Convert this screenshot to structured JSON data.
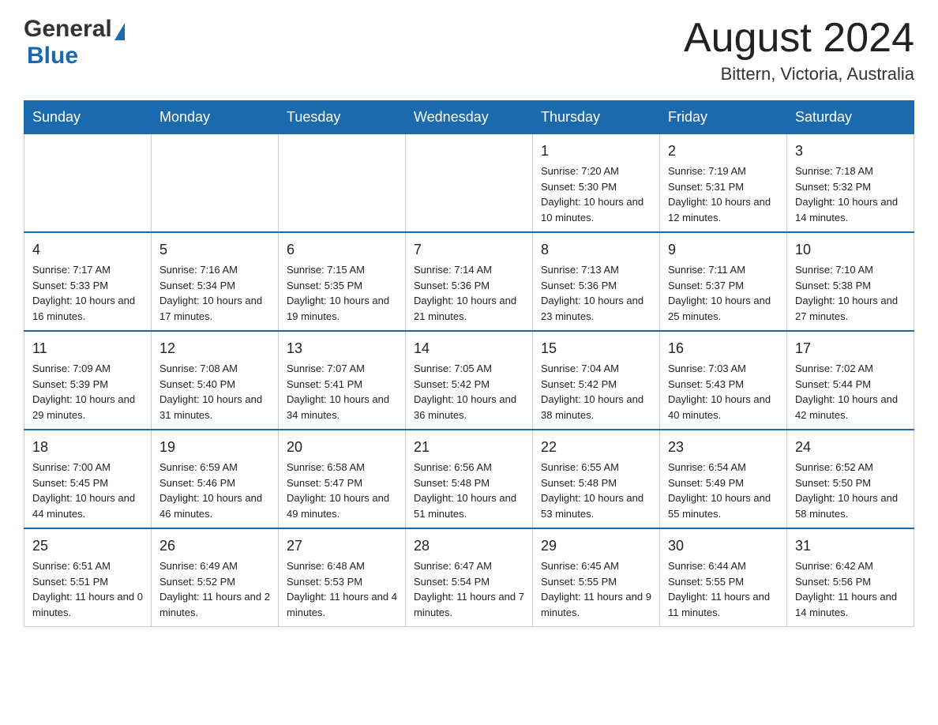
{
  "header": {
    "logo": {
      "general": "General",
      "blue": "Blue",
      "triangle": "▲"
    },
    "title": "August 2024",
    "location": "Bittern, Victoria, Australia"
  },
  "calendar": {
    "days": [
      "Sunday",
      "Monday",
      "Tuesday",
      "Wednesday",
      "Thursday",
      "Friday",
      "Saturday"
    ],
    "weeks": [
      {
        "cells": [
          {
            "day": "",
            "info": ""
          },
          {
            "day": "",
            "info": ""
          },
          {
            "day": "",
            "info": ""
          },
          {
            "day": "",
            "info": ""
          },
          {
            "day": "1",
            "info": "Sunrise: 7:20 AM\nSunset: 5:30 PM\nDaylight: 10 hours and 10 minutes."
          },
          {
            "day": "2",
            "info": "Sunrise: 7:19 AM\nSunset: 5:31 PM\nDaylight: 10 hours and 12 minutes."
          },
          {
            "day": "3",
            "info": "Sunrise: 7:18 AM\nSunset: 5:32 PM\nDaylight: 10 hours and 14 minutes."
          }
        ]
      },
      {
        "cells": [
          {
            "day": "4",
            "info": "Sunrise: 7:17 AM\nSunset: 5:33 PM\nDaylight: 10 hours and 16 minutes."
          },
          {
            "day": "5",
            "info": "Sunrise: 7:16 AM\nSunset: 5:34 PM\nDaylight: 10 hours and 17 minutes."
          },
          {
            "day": "6",
            "info": "Sunrise: 7:15 AM\nSunset: 5:35 PM\nDaylight: 10 hours and 19 minutes."
          },
          {
            "day": "7",
            "info": "Sunrise: 7:14 AM\nSunset: 5:36 PM\nDaylight: 10 hours and 21 minutes."
          },
          {
            "day": "8",
            "info": "Sunrise: 7:13 AM\nSunset: 5:36 PM\nDaylight: 10 hours and 23 minutes."
          },
          {
            "day": "9",
            "info": "Sunrise: 7:11 AM\nSunset: 5:37 PM\nDaylight: 10 hours and 25 minutes."
          },
          {
            "day": "10",
            "info": "Sunrise: 7:10 AM\nSunset: 5:38 PM\nDaylight: 10 hours and 27 minutes."
          }
        ]
      },
      {
        "cells": [
          {
            "day": "11",
            "info": "Sunrise: 7:09 AM\nSunset: 5:39 PM\nDaylight: 10 hours and 29 minutes."
          },
          {
            "day": "12",
            "info": "Sunrise: 7:08 AM\nSunset: 5:40 PM\nDaylight: 10 hours and 31 minutes."
          },
          {
            "day": "13",
            "info": "Sunrise: 7:07 AM\nSunset: 5:41 PM\nDaylight: 10 hours and 34 minutes."
          },
          {
            "day": "14",
            "info": "Sunrise: 7:05 AM\nSunset: 5:42 PM\nDaylight: 10 hours and 36 minutes."
          },
          {
            "day": "15",
            "info": "Sunrise: 7:04 AM\nSunset: 5:42 PM\nDaylight: 10 hours and 38 minutes."
          },
          {
            "day": "16",
            "info": "Sunrise: 7:03 AM\nSunset: 5:43 PM\nDaylight: 10 hours and 40 minutes."
          },
          {
            "day": "17",
            "info": "Sunrise: 7:02 AM\nSunset: 5:44 PM\nDaylight: 10 hours and 42 minutes."
          }
        ]
      },
      {
        "cells": [
          {
            "day": "18",
            "info": "Sunrise: 7:00 AM\nSunset: 5:45 PM\nDaylight: 10 hours and 44 minutes."
          },
          {
            "day": "19",
            "info": "Sunrise: 6:59 AM\nSunset: 5:46 PM\nDaylight: 10 hours and 46 minutes."
          },
          {
            "day": "20",
            "info": "Sunrise: 6:58 AM\nSunset: 5:47 PM\nDaylight: 10 hours and 49 minutes."
          },
          {
            "day": "21",
            "info": "Sunrise: 6:56 AM\nSunset: 5:48 PM\nDaylight: 10 hours and 51 minutes."
          },
          {
            "day": "22",
            "info": "Sunrise: 6:55 AM\nSunset: 5:48 PM\nDaylight: 10 hours and 53 minutes."
          },
          {
            "day": "23",
            "info": "Sunrise: 6:54 AM\nSunset: 5:49 PM\nDaylight: 10 hours and 55 minutes."
          },
          {
            "day": "24",
            "info": "Sunrise: 6:52 AM\nSunset: 5:50 PM\nDaylight: 10 hours and 58 minutes."
          }
        ]
      },
      {
        "cells": [
          {
            "day": "25",
            "info": "Sunrise: 6:51 AM\nSunset: 5:51 PM\nDaylight: 11 hours and 0 minutes."
          },
          {
            "day": "26",
            "info": "Sunrise: 6:49 AM\nSunset: 5:52 PM\nDaylight: 11 hours and 2 minutes."
          },
          {
            "day": "27",
            "info": "Sunrise: 6:48 AM\nSunset: 5:53 PM\nDaylight: 11 hours and 4 minutes."
          },
          {
            "day": "28",
            "info": "Sunrise: 6:47 AM\nSunset: 5:54 PM\nDaylight: 11 hours and 7 minutes."
          },
          {
            "day": "29",
            "info": "Sunrise: 6:45 AM\nSunset: 5:55 PM\nDaylight: 11 hours and 9 minutes."
          },
          {
            "day": "30",
            "info": "Sunrise: 6:44 AM\nSunset: 5:55 PM\nDaylight: 11 hours and 11 minutes."
          },
          {
            "day": "31",
            "info": "Sunrise: 6:42 AM\nSunset: 5:56 PM\nDaylight: 11 hours and 14 minutes."
          }
        ]
      }
    ]
  }
}
